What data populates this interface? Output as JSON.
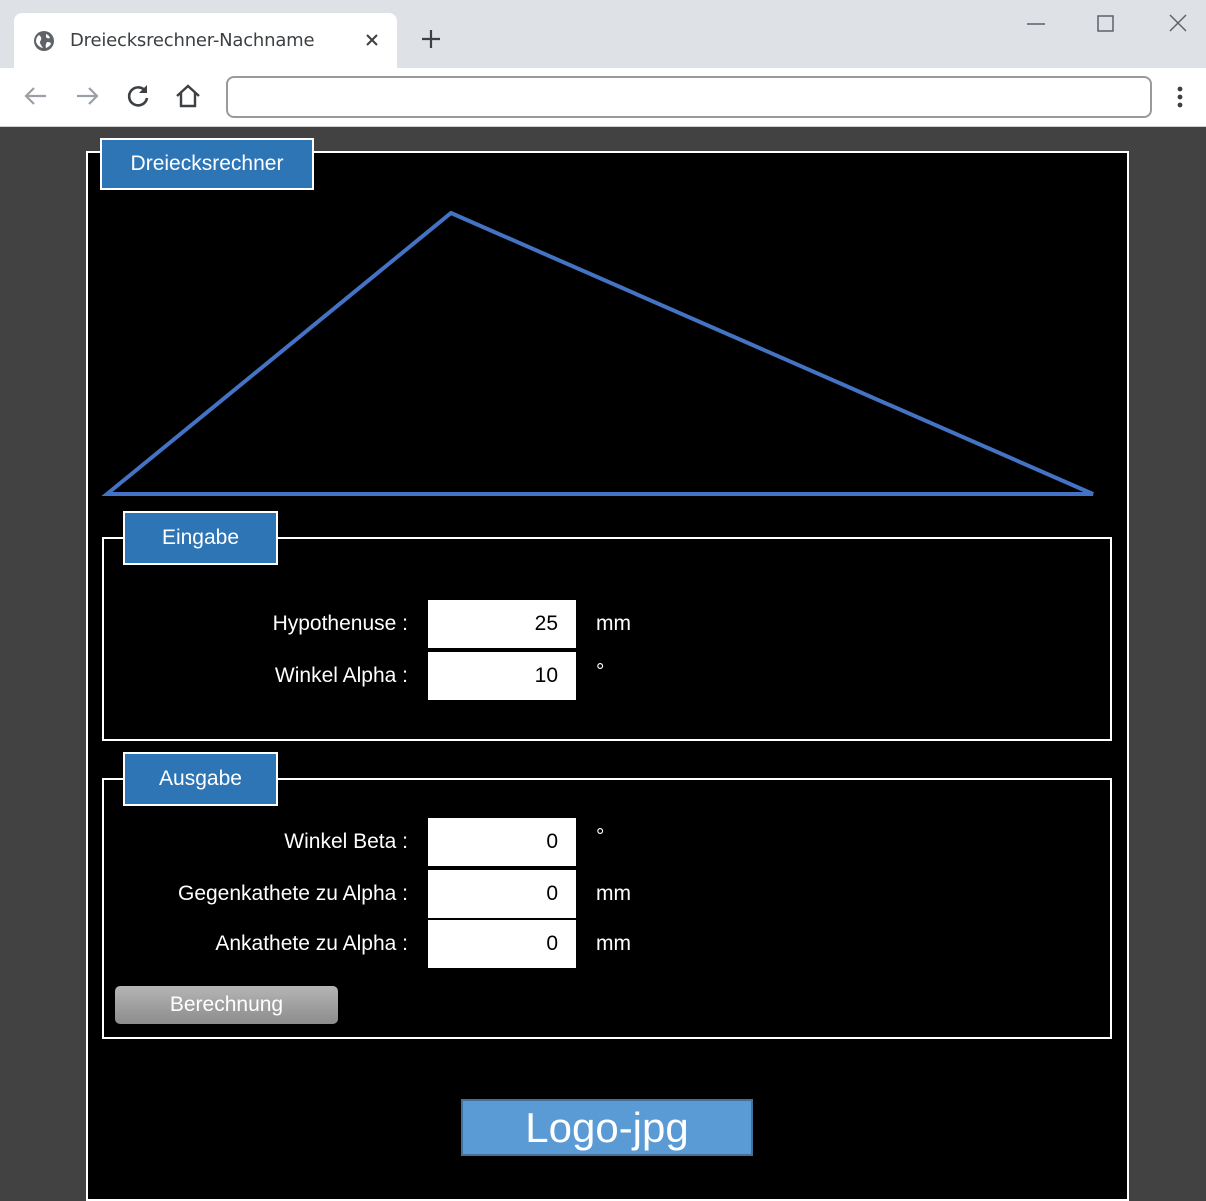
{
  "browser": {
    "tab_title": "Dreiecksrechner-Nachname",
    "address": ""
  },
  "app": {
    "title": "Dreiecksrechner"
  },
  "input_section": {
    "title": "Eingabe",
    "fields": [
      {
        "label": "Hypothenuse :",
        "value": "25",
        "unit": "mm"
      },
      {
        "label": "Winkel Alpha :",
        "value": "10",
        "unit": "°"
      }
    ]
  },
  "output_section": {
    "title": "Ausgabe",
    "fields": [
      {
        "label": "Winkel Beta :",
        "value": "0",
        "unit": "°"
      },
      {
        "label": "Gegenkathete zu  Alpha :",
        "value": "0",
        "unit": "mm"
      },
      {
        "label": "Ankathete zu Alpha :",
        "value": "0",
        "unit": "mm"
      }
    ],
    "button_label": "Berechnung"
  },
  "logo_text": "Logo-jpg",
  "colors": {
    "accent": "#2e75b6",
    "triangle_stroke": "#4472c4",
    "logo": "#5b9bd5",
    "background": "#000000"
  }
}
